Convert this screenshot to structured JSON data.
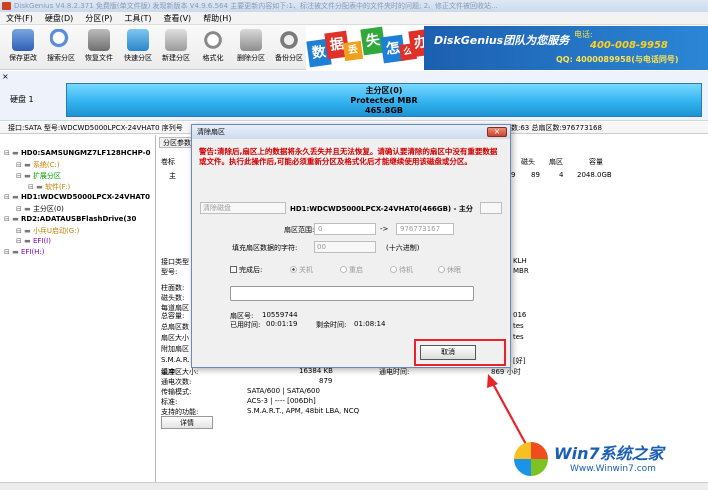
{
  "window": {
    "title": "DiskGenius V4.8.2.371 免费版(单文件版)   发现新版本 V4.9.6.564 主要更新内容如下:1、标注被文件分配表中的文件夹时的问题; 2、修正文件被回收站..."
  },
  "menu": [
    "文件(F)",
    "硬盘(D)",
    "分区(P)",
    "工具(T)",
    "查看(V)",
    "帮助(H)"
  ],
  "toolbar": [
    {
      "label": "保存更改",
      "icon": "save-icon"
    },
    {
      "label": "搜索分区",
      "icon": "search-icon"
    },
    {
      "label": "恢复文件",
      "icon": "recover-icon"
    },
    {
      "label": "快速分区",
      "icon": "quick-partition-icon"
    },
    {
      "label": "新建分区",
      "icon": "new-partition-icon"
    },
    {
      "label": "格式化",
      "icon": "format-icon"
    },
    {
      "label": "删除分区",
      "icon": "delete-partition-icon"
    },
    {
      "label": "备份分区",
      "icon": "backup-icon"
    }
  ],
  "banner": {
    "chars": [
      "数",
      "据",
      "丢",
      "失",
      "怎",
      "么",
      "办"
    ],
    "brand": "DiskGenius团队为您服务",
    "phone": "400-008-9958",
    "phone_label": "电话:",
    "qq": "QQ: 4000089958(与电话同号)"
  },
  "disk": {
    "label": "硬盘 1",
    "partition_name": "主分区(0)",
    "partition_type": "Protected MBR",
    "partition_size": "465.8GB"
  },
  "infobar": {
    "left": "接口:SATA  型号:WDCWD5000LPCX-24VHAT0  序列号",
    "right": "区数:63  总扇区数:976773168"
  },
  "tree": [
    {
      "text": "HD0:SAMSUNGMZ7LF128HCHP-0",
      "level": 0,
      "bold": true
    },
    {
      "text": "系统(C:)",
      "level": 1,
      "color": "#c08000"
    },
    {
      "text": "扩展分区",
      "level": 1,
      "color": "#00a000"
    },
    {
      "text": "软件(F:)",
      "level": 2,
      "color": "#c08000"
    },
    {
      "text": "HD1:WDCWD5000LPCX-24VHAT0",
      "level": 0,
      "bold": true
    },
    {
      "text": "主分区(0)",
      "level": 1,
      "color": "#000000"
    },
    {
      "text": "RD2:ADATAUSBFlashDrive(30",
      "level": 0,
      "bold": true
    },
    {
      "text": "小兵U启动(G:)",
      "level": 1,
      "color": "#c08000"
    },
    {
      "text": "EFI(I)",
      "level": 1,
      "color": "#8000c0"
    },
    {
      "text": "EFI(H:)",
      "level": 0,
      "color": "#8000c0"
    }
  ],
  "right_panel": {
    "tab": "分区参数",
    "col_label": "卷标",
    "head_cols": [
      "磁头",
      "扇区",
      "容量"
    ],
    "row_values": [
      "9",
      "89",
      "4",
      "2048.0GB"
    ],
    "row_label": "主",
    "labels": [
      "接口类型",
      "型号:",
      "柱面数:",
      "磁头数:",
      "每道扇区",
      "总容量:",
      "总扇区数",
      "扇区大小",
      "附加扇区",
      "S.M.A.R.",
      "温度:",
      "通电时间:",
      "通电次数:",
      "传输模式:",
      "标准:",
      "支持的功能:"
    ],
    "right_values": [
      "KLH",
      "MBR",
      "016",
      "tes",
      "tes"
    ],
    "smart_right": "[好]",
    "buffer_label": "缓冲区大小:",
    "buffer_value": "16384 KB",
    "power_time_label": "通电时间:",
    "power_time_value": "869 小时",
    "power_count_value": "879",
    "transfer_value": "SATA/600 | SATA/600",
    "standard_value": "ACS-3 | ---- [006Dh]",
    "features_value": "S.M.A.R.T., APM, 48bit LBA, NCQ",
    "details_button": "详情"
  },
  "dialog": {
    "title": "清除扇区",
    "close": "×",
    "warning": "警告:清除后,扇区上的数据将永久丢失并且无法恢复。请确认要清除的扇区中没有重要数据或文件。执行此操作后,可能必须重新分区及格式化后才能继续使用该磁盘或分区。",
    "target_dropdown": "清除磁盘",
    "target_text": "HD1:WDCWD5000LPCX-24VHAT0(466GB) - 主分",
    "range_label": "扇区范围:",
    "range_from": "0",
    "range_arrow": "->",
    "range_to": "976773167",
    "fill_label": "填充扇区数据的字符:",
    "fill_value": "00",
    "fill_unit": "(十六进制)",
    "on_complete_label": "完成后:",
    "options": [
      {
        "label": "关机",
        "selected": true
      },
      {
        "label": "重启",
        "selected": false
      },
      {
        "label": "待机",
        "selected": false
      },
      {
        "label": "休眠",
        "selected": false
      }
    ],
    "sector_no_label": "扇区号:",
    "sector_no": "10559744",
    "elapsed_label": "已用时间:",
    "elapsed": "00:01:19",
    "remaining_label": "剩余时间:",
    "remaining": "01:08:14",
    "cancel": "取消"
  },
  "watermark": {
    "line1": "Win7系统之家",
    "line2": "Www.Winwin7.com"
  },
  "colors": {
    "warning": "#d10000",
    "highlight": "#e8232a",
    "partition_bar": "#33b3ef"
  }
}
